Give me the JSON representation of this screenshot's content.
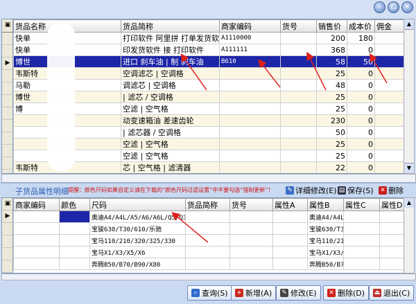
{
  "top_grid": {
    "columns": [
      "货品名称",
      "货品简称",
      "商家编码",
      "货号",
      "销售价",
      "成本价",
      "佣金"
    ],
    "rows": [
      {
        "name": "快单",
        "short": "打印软件 阿里拼 打单发货软件",
        "code": "A1110000",
        "no": "",
        "price": "200",
        "cost": "180",
        "comm": ""
      },
      {
        "name": "快单",
        "short": "印发货软件 接 打印软件",
        "code": "A111111",
        "no": "",
        "price": "368",
        "cost": "0",
        "comm": ""
      },
      {
        "name": "博世",
        "short": "进口 刹车油 | 制 刹车油",
        "code": "B610",
        "no": "",
        "price": "58",
        "cost": "50",
        "comm": ""
      },
      {
        "name": "韦斯特",
        "short": "空调滤芯 | 空调格",
        "code": "",
        "no": "",
        "price": "25",
        "cost": "0",
        "comm": ""
      },
      {
        "name": "马勒",
        "short": "调滤芯 | 空调格",
        "code": "",
        "no": "",
        "price": "48",
        "cost": "0",
        "comm": ""
      },
      {
        "name": "博世",
        "short": "| 滤芯 / 空调格",
        "code": "",
        "no": "",
        "price": "25",
        "cost": "0",
        "comm": ""
      },
      {
        "name": "博",
        "short": "空滤 | 空气格",
        "code": "",
        "no": "",
        "price": "25",
        "cost": "0",
        "comm": ""
      },
      {
        "name": "",
        "short": "动变速箱油 差速齿轮",
        "code": "",
        "no": "",
        "price": "230",
        "cost": "0",
        "comm": ""
      },
      {
        "name": "",
        "short": "| 滤芯器 / 空调格",
        "code": "",
        "no": "",
        "price": "50",
        "cost": "0",
        "comm": ""
      },
      {
        "name": "",
        "short": "空滤 | 空气格",
        "code": "",
        "no": "",
        "price": "25",
        "cost": "0",
        "comm": ""
      },
      {
        "name": "",
        "short": "空滤 | 空气格",
        "code": "",
        "no": "",
        "price": "25",
        "cost": "0",
        "comm": ""
      },
      {
        "name": "韦斯特",
        "short": "芯 | 空气格 | 滤清器",
        "code": "",
        "no": "",
        "price": "22",
        "cost": "0",
        "comm": ""
      }
    ]
  },
  "sub_panel": {
    "title": "子货品属性明细",
    "note": "提醒：颜色尺码如果自定义请在下载的“颜色尺码过滤设置”中不要勾选“强制更新”！",
    "buttons": [
      "详细修改(E)",
      "保存(S)",
      "删除"
    ]
  },
  "bottom_grid": {
    "columns": [
      "商家编码",
      "颜色",
      "尺码",
      "货品简称",
      "货号",
      "属性A",
      "属性B",
      "属性C",
      "属性D",
      "属"
    ],
    "rows": [
      {
        "size": "奥迪A4/A4L/A5/A6/A6L/Q5/Q3",
        "attrB": "奥迪A4/A4L/A"
      },
      {
        "size": "宝骏630/T30/610/乐驰",
        "attrB": "宝骏630/T30/"
      },
      {
        "size": "宝马110/210/320/325/330",
        "attrB": "宝马110/210/"
      },
      {
        "size": "宝马X1/X3/X5/X6",
        "attrB": "宝马X1/X3/X5"
      },
      {
        "size": "奔腾B50/B70/B90/X80",
        "attrB": "奔腾B50/B70/"
      }
    ]
  },
  "toolbar": {
    "query": "查询(S)",
    "add": "新增(A)",
    "edit": "修改(E)",
    "delete": "删除(D)",
    "exit": "退出(C)"
  },
  "colors": {
    "selected_row": "#1e26a8",
    "alt_row": "#fbf6e4",
    "note_red": "#d01010",
    "annotation_arrow": "#e0201a"
  }
}
